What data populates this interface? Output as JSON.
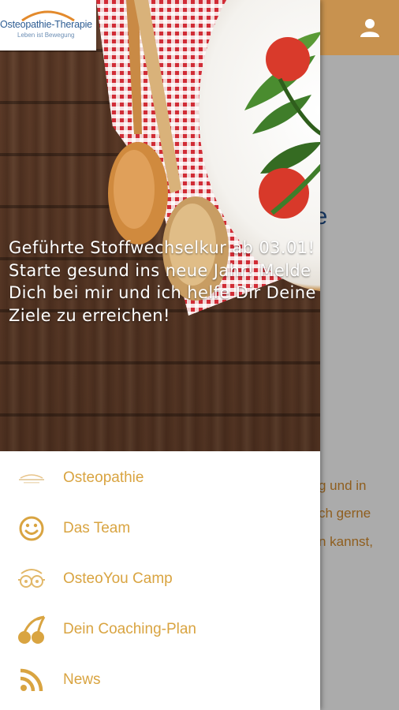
{
  "app": {
    "accent_color": "#c8924f",
    "menu_color": "#d9a441",
    "icons": {
      "user": "user-icon"
    }
  },
  "background_page": {
    "heading_fragment": "ie",
    "lines": [
      "g und in",
      "ch gerne",
      "n kannst,"
    ]
  },
  "drawer": {
    "logo": {
      "name": "Osteopathie-Therapie",
      "tagline": "Leben ist Bewegung"
    },
    "hero_text": "Geführte Stoffwechselkur ab 03.01! Starte gesund ins neue Jahr! Melde Dich bei mir und ich helfe Dir Deine Ziele zu erreichen!",
    "menu": [
      {
        "label": "Osteopathie",
        "icon": "logo-icon"
      },
      {
        "label": "Das Team",
        "icon": "smiley-icon"
      },
      {
        "label": "OsteoYou Camp",
        "icon": "glasses-face-icon"
      },
      {
        "label": "Dein Coaching-Plan",
        "icon": "cherries-icon"
      },
      {
        "label": "News",
        "icon": "rss-icon"
      }
    ]
  }
}
